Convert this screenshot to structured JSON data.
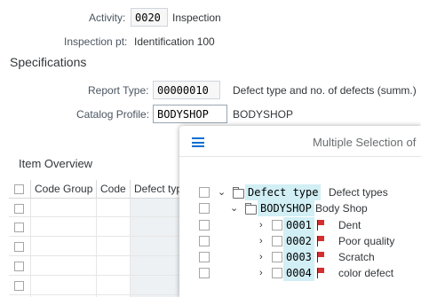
{
  "header": {
    "activity_label": "Activity:",
    "activity_value": "0020",
    "activity_text": "Inspection",
    "inspection_pt_label": "Inspection pt:",
    "inspection_pt_value": "Identification 100"
  },
  "specifications": {
    "title": "Specifications",
    "report_type_label": "Report Type:",
    "report_type_value": "00000010",
    "report_type_text": "Defect type and no. of defects (summ.)",
    "catalog_profile_label": "Catalog Profile:",
    "catalog_profile_value": "BODYSHOP",
    "catalog_profile_text": "BODYSHOP"
  },
  "item_overview": {
    "title": "Item Overview",
    "columns": [
      "Code Group",
      "Code",
      "Defect typ"
    ]
  },
  "popup": {
    "title": "Multiple Selection of",
    "root": {
      "code": "Defect type",
      "text": "Defect types"
    },
    "group": {
      "code": "BODYSHOP",
      "text": "Body Shop"
    },
    "items": [
      {
        "code": "0001",
        "text": "Dent"
      },
      {
        "code": "0002",
        "text": "Poor quality"
      },
      {
        "code": "0003",
        "text": "Scratch"
      },
      {
        "code": "0004",
        "text": "color defect"
      }
    ],
    "flag_color": "#d32f2f",
    "highlight_color": "#d1eff5"
  }
}
